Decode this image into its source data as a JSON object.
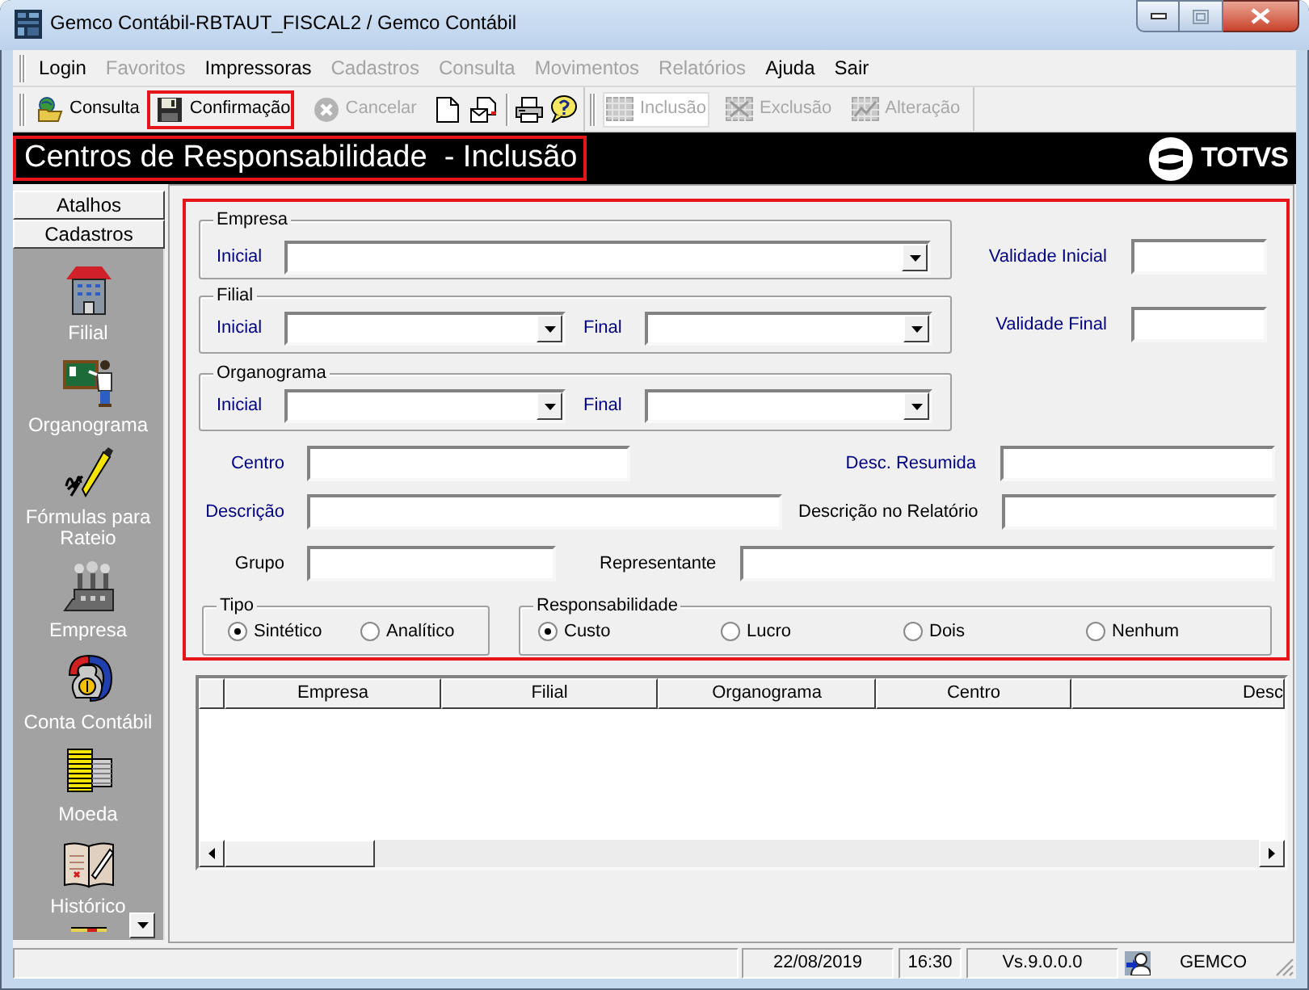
{
  "window": {
    "title": "Gemco Contábil-RBTAUT_FISCAL2 / Gemco Contábil"
  },
  "menu": [
    {
      "label": "Login",
      "disabled": false
    },
    {
      "label": "Favoritos",
      "disabled": true
    },
    {
      "label": "Impressoras",
      "disabled": false
    },
    {
      "label": "Cadastros",
      "disabled": true
    },
    {
      "label": "Consulta",
      "disabled": true
    },
    {
      "label": "Movimentos",
      "disabled": true
    },
    {
      "label": "Relatórios",
      "disabled": true
    },
    {
      "label": "Ajuda",
      "disabled": false
    },
    {
      "label": "Sair",
      "disabled": false
    }
  ],
  "toolbar": {
    "actions": [
      {
        "label": "Consulta",
        "disabled": false,
        "highlighted": false
      },
      {
        "label": "Confirmação",
        "disabled": false,
        "highlighted": true
      },
      {
        "label": "Cancelar",
        "disabled": true,
        "highlighted": false
      }
    ],
    "modes": [
      {
        "label": "Inclusão",
        "disabled": true,
        "selected": true
      },
      {
        "label": "Exclusão",
        "disabled": true,
        "selected": false
      },
      {
        "label": "Alteração",
        "disabled": true,
        "selected": false
      }
    ]
  },
  "header": {
    "title": "Centros de Responsabilidade  - Inclusão",
    "highlighted": true,
    "logo": "TOTVS"
  },
  "sidebar": {
    "tabs": [
      "Atalhos",
      "Cadastros"
    ],
    "items": [
      "Filial",
      "Organograma",
      "Fórmulas para Rateio",
      "Empresa",
      "Conta Contábil",
      "Moeda",
      "Histórico"
    ]
  },
  "form": {
    "highlighted": true,
    "ranges": [
      {
        "title": "Empresa",
        "fields": [
          {
            "label": "Inicial",
            "required": true
          }
        ]
      },
      {
        "title": "Filial",
        "fields": [
          {
            "label": "Inicial",
            "required": true
          },
          {
            "label": "Final",
            "required": true
          }
        ]
      },
      {
        "title": "Organograma",
        "fields": [
          {
            "label": "Inicial",
            "required": true
          },
          {
            "label": "Final",
            "required": true
          }
        ]
      }
    ],
    "validity": [
      {
        "label": "Validade Inicial",
        "required": true
      },
      {
        "label": "Validade Final",
        "required": true
      }
    ],
    "rows": [
      {
        "fields": [
          {
            "label": "Centro",
            "required": true
          },
          {
            "label": "Desc. Resumida",
            "required": true
          }
        ]
      },
      {
        "fields": [
          {
            "label": "Descrição",
            "required": true
          },
          {
            "label": "Descrição no Relatório",
            "required": false
          }
        ]
      },
      {
        "fields": [
          {
            "label": "Grupo",
            "required": false
          },
          {
            "label": "Representante",
            "required": false
          }
        ]
      }
    ],
    "tipo": {
      "title": "Tipo",
      "options": [
        {
          "label": "Sintético",
          "selected": true
        },
        {
          "label": "Analítico",
          "selected": false
        }
      ]
    },
    "responsabilidade": {
      "title": "Responsabilidade",
      "options": [
        {
          "label": "Custo",
          "selected": true
        },
        {
          "label": "Lucro",
          "selected": false
        },
        {
          "label": "Dois",
          "selected": false
        },
        {
          "label": "Nenhum",
          "selected": false
        }
      ]
    }
  },
  "table": {
    "columns": [
      "Empresa",
      "Filial",
      "Organograma",
      "Centro",
      "Desc"
    ]
  },
  "status_bar": {
    "date": "22/08/2019",
    "time": "16:30",
    "version": "Vs.9.0.0.0",
    "user": "GEMCO"
  }
}
